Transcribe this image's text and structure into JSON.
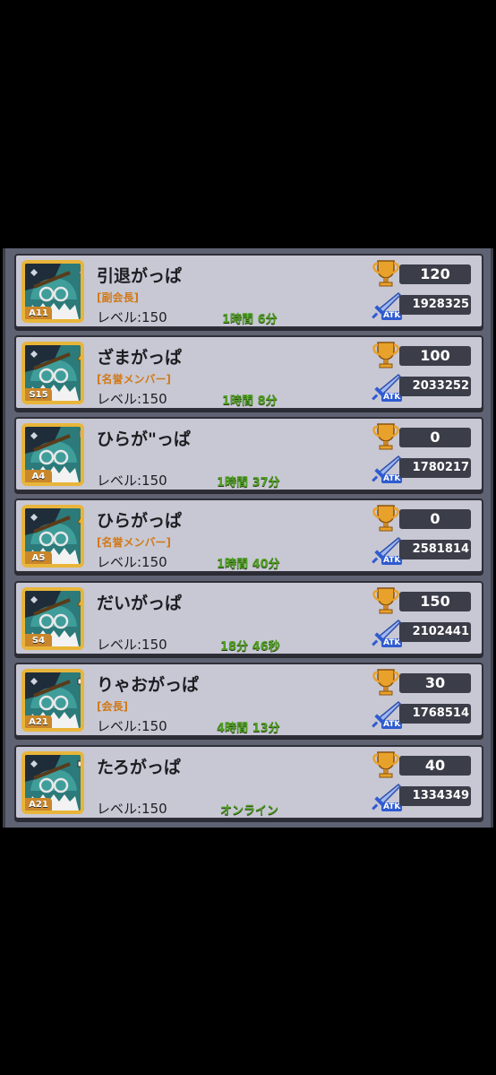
{
  "colors": {
    "panel": "#5f6272",
    "card": "#c8c8d4",
    "avatar_frame": "#e8b53a",
    "role_text": "#d07a1a",
    "online_time": "#4fa022"
  },
  "icons": {
    "trophy": "trophy-icon",
    "attack": "sword-icon"
  },
  "members": [
    {
      "name": "引退がっぱ",
      "role": "[副会長]",
      "level": "レベル:150",
      "last_seen": "1時間 6分",
      "trophies": "120",
      "atk_label": "ATK",
      "atk": "1928325",
      "rank": "A11",
      "badge": "diamond-badge-icon"
    },
    {
      "name": "ざまがっぱ",
      "role": "[名誉メンバー]",
      "level": "レベル:150",
      "last_seen": "1時間 8分",
      "trophies": "100",
      "atk_label": "ATK",
      "atk": "2033252",
      "rank": "S15",
      "badge": "horn-badge-icon"
    },
    {
      "name": "ひらが\"っぱ",
      "role": "",
      "level": "レベル:150",
      "last_seen": "1時間 37分",
      "trophies": "0",
      "atk_label": "ATK",
      "atk": "1780217",
      "rank": "A4",
      "badge": "cleaver-badge-icon"
    },
    {
      "name": "ひらがっぱ",
      "role": "[名誉メンバー]",
      "level": "レベル:150",
      "last_seen": "1時間 40分",
      "trophies": "0",
      "atk_label": "ATK",
      "atk": "2581814",
      "rank": "A5",
      "badge": "horn-badge-icon"
    },
    {
      "name": "だいがっぱ",
      "role": "",
      "level": "レベル:150",
      "last_seen": "18分 46秒",
      "trophies": "150",
      "atk_label": "ATK",
      "atk": "2102441",
      "rank": "S4",
      "badge": "horn-badge-icon"
    },
    {
      "name": "りゃおがっぱ",
      "role": "[会長]",
      "level": "レベル:150",
      "last_seen": "4時間 13分",
      "trophies": "30",
      "atk_label": "ATK",
      "atk": "1768514",
      "rank": "A21",
      "badge": "gun-badge-icon"
    },
    {
      "name": "たろがっぱ",
      "role": "",
      "level": "レベル:150",
      "last_seen": "オンライン",
      "trophies": "40",
      "atk_label": "ATK",
      "atk": "1334349",
      "rank": "A21",
      "badge": "gun-badge-icon"
    }
  ]
}
